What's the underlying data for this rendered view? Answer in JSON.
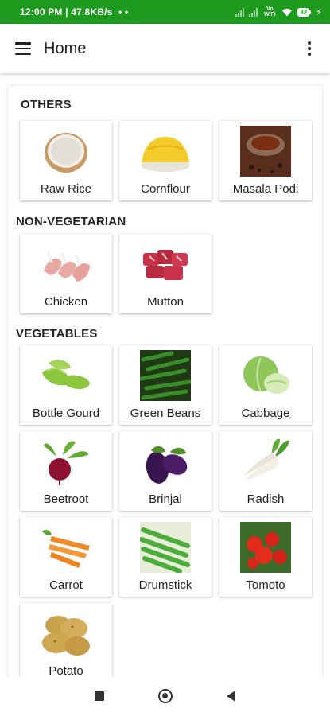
{
  "status_bar": {
    "time_speed": "12:00 PM | 47.8KB/s",
    "dots": "• •",
    "volte": "Vo WiFi",
    "battery": "82"
  },
  "app_bar": {
    "title": "Home"
  },
  "sections": [
    {
      "title": "OTHERS",
      "items": [
        "Raw Rice",
        "Cornflour",
        "Masala Podi"
      ]
    },
    {
      "title": "NON-VEGETARIAN",
      "items": [
        "Chicken",
        "Mutton"
      ]
    },
    {
      "title": "VEGETABLES",
      "items": [
        "Bottle Gourd",
        "Green Beans",
        "Cabbage",
        "Beetroot",
        "Brinjal",
        "Radish",
        "Carrot",
        "Drumstick",
        "Tomoto",
        "Potato"
      ]
    }
  ],
  "colors": {
    "status_bar": "#1e9b1e",
    "background": "#ffffff",
    "text": "#222222"
  }
}
